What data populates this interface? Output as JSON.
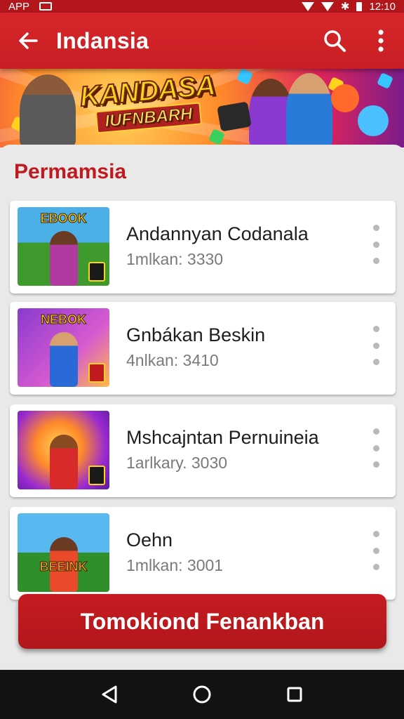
{
  "status_bar": {
    "carrier": "APP",
    "time": "12:10"
  },
  "app_bar": {
    "title": "Indansia"
  },
  "banner": {
    "title_line1": "KANDASA",
    "title_line2": "IUFNBARH"
  },
  "section": {
    "title": "Permamsia"
  },
  "items": [
    {
      "title": "Andannyan Codanala",
      "subtitle": "1mlkan: 3330",
      "thumb_label": "EBOOK",
      "thumb_color_top": "#4bb0e8",
      "thumb_color_bottom": "#3f9a2e"
    },
    {
      "title": "Gnbákan Beskin",
      "subtitle": "4nlkan: 3410",
      "thumb_label": "NEBOK",
      "thumb_color_top": "#8a3ad0",
      "thumb_color_bottom": "#d65ad0"
    },
    {
      "title": "Mshcajntan Pernuineia",
      "subtitle": "1arlkary. 3030",
      "thumb_label": "",
      "thumb_color_top": "#5a1aa0",
      "thumb_color_bottom": "#ff8a2a"
    },
    {
      "title": "Oehn",
      "subtitle": "1mlkan: 3001",
      "thumb_label": "BEEINK",
      "thumb_color_top": "#58b8f0",
      "thumb_color_bottom": "#2f8f2a"
    }
  ],
  "cta": {
    "label": "Tomokiond Fenankban"
  },
  "colors": {
    "primary": "#c81f24",
    "status_bar": "#b3161b",
    "nav_bar": "#121212",
    "accent_text": "#c0191f"
  }
}
